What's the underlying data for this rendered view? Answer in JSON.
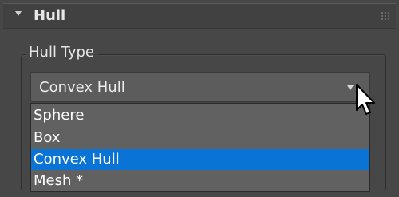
{
  "rollout": {
    "title": "Hull",
    "collapse_icon": "chevron-down-icon",
    "grip_icon": "drag-grip-icon"
  },
  "group": {
    "label": "Hull Type"
  },
  "dropdown": {
    "value": "Convex Hull",
    "options": [
      {
        "label": "Sphere",
        "selected": false
      },
      {
        "label": "Box",
        "selected": false
      },
      {
        "label": "Convex Hull",
        "selected": true
      },
      {
        "label": "Mesh *",
        "selected": false
      }
    ]
  },
  "colors": {
    "panel_bg": "#474747",
    "selection": "#0a74d6",
    "text": "#ffffff"
  },
  "cursor": {
    "icon": "mouse-pointer-icon"
  }
}
